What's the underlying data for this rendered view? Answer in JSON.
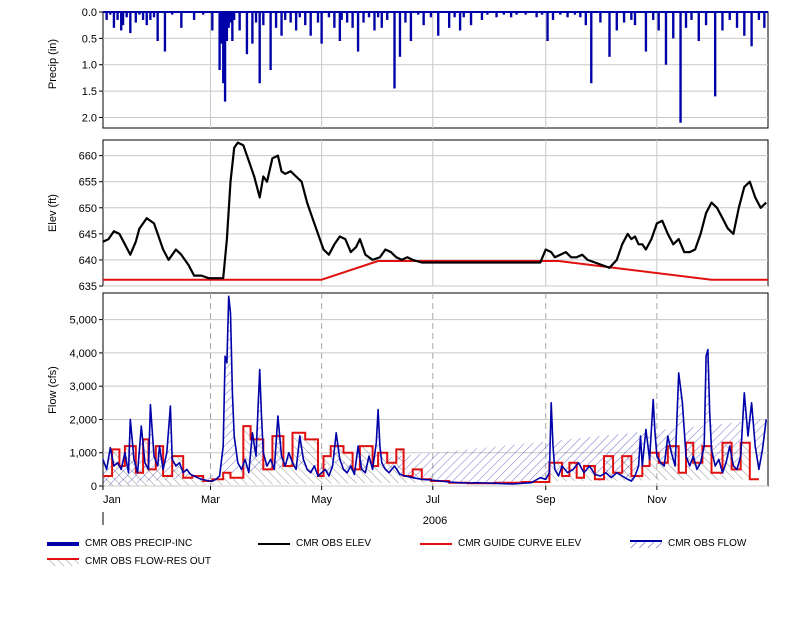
{
  "chart_data": [
    {
      "type": "bar",
      "ylabel": "Precip (in)",
      "ylim": [
        0.0,
        2.2
      ],
      "y_inverted": true,
      "yticks": [
        "0.0",
        "0.5",
        "1.0",
        "1.5",
        "2.0"
      ],
      "ytick_values": [
        0.0,
        0.5,
        1.0,
        1.5,
        2.0
      ],
      "color": "#0000a8",
      "x_days": [
        2,
        4,
        6,
        8,
        10,
        11,
        13,
        15,
        18,
        20,
        22,
        24,
        26,
        28,
        30,
        34,
        38,
        43,
        50,
        55,
        60,
        64,
        65,
        66,
        67,
        68,
        69,
        70,
        71,
        72,
        75,
        79,
        82,
        84,
        86,
        88,
        92,
        95,
        98,
        100,
        103,
        106,
        108,
        111,
        114,
        118,
        120,
        124,
        127,
        130,
        131,
        134,
        137,
        140,
        143,
        146,
        149,
        151,
        153,
        156,
        160,
        163,
        166,
        169,
        173,
        176,
        180,
        184,
        190,
        193,
        196,
        198,
        202,
        208,
        211,
        216,
        220,
        224,
        227,
        232,
        238,
        241,
        244,
        247,
        251,
        255,
        259,
        262,
        265,
        268,
        273,
        278,
        282,
        286,
        290,
        292,
        298,
        302,
        305,
        309,
        313,
        317,
        320,
        323,
        327,
        331,
        336,
        340,
        344,
        348,
        352,
        356,
        360,
        363
      ],
      "values": [
        0.15,
        0.05,
        0.3,
        0.15,
        0.35,
        0.25,
        0.1,
        0.4,
        0.2,
        0.05,
        0.15,
        0.25,
        0.15,
        0.1,
        0.55,
        0.75,
        0.05,
        0.3,
        0.15,
        0.05,
        0.35,
        1.1,
        0.6,
        1.35,
        1.7,
        0.55,
        0.3,
        0.2,
        0.55,
        0.15,
        0.35,
        0.8,
        0.6,
        0.2,
        1.35,
        0.25,
        1.1,
        0.3,
        0.45,
        0.15,
        0.2,
        0.35,
        0.1,
        0.25,
        0.45,
        0.2,
        0.6,
        0.1,
        0.3,
        0.55,
        0.15,
        0.2,
        0.3,
        0.75,
        0.2,
        0.1,
        0.35,
        0.1,
        0.3,
        0.15,
        1.45,
        0.85,
        0.2,
        0.55,
        0.05,
        0.25,
        0.1,
        0.45,
        0.3,
        0.1,
        0.35,
        0.1,
        0.25,
        0.15,
        0.05,
        0.1,
        0.05,
        0.1,
        0.05,
        0.05,
        0.1,
        0.05,
        0.55,
        0.15,
        0.05,
        0.1,
        0.05,
        0.1,
        0.25,
        1.35,
        0.2,
        0.85,
        0.35,
        0.2,
        0.15,
        0.25,
        0.75,
        0.15,
        0.35,
        1.0,
        0.5,
        2.1,
        0.3,
        0.15,
        0.55,
        0.25,
        1.6,
        0.35,
        0.15,
        0.3,
        0.45,
        0.65,
        0.15,
        0.3,
        0.75,
        0.45
      ]
    },
    {
      "type": "line",
      "ylabel": "Elev (ft)",
      "ylim": [
        635,
        663
      ],
      "yticks": [
        "635",
        "640",
        "645",
        "650",
        "655",
        "660"
      ],
      "ytick_values": [
        635,
        640,
        645,
        650,
        655,
        660
      ],
      "series": [
        {
          "name": "CMR OBS ELEV",
          "color": "#000000",
          "x_days": [
            0,
            3,
            6,
            9,
            12,
            15,
            18,
            20,
            24,
            28,
            30,
            33,
            36,
            40,
            43,
            47,
            50,
            54,
            58,
            62,
            66,
            68,
            70,
            72,
            74,
            77,
            80,
            83,
            86,
            88,
            90,
            93,
            96,
            98,
            100,
            103,
            106,
            109,
            112,
            115,
            118,
            121,
            124,
            127,
            130,
            133,
            136,
            139,
            141,
            144,
            148,
            152,
            155,
            158,
            161,
            164,
            167,
            170,
            175,
            180,
            190,
            200,
            210,
            220,
            230,
            240,
            243,
            246,
            248,
            251,
            254,
            257,
            260,
            263,
            266,
            270,
            274,
            278,
            282,
            285,
            288,
            290,
            292,
            294,
            296,
            298,
            301,
            304,
            307,
            310,
            313,
            316,
            319,
            322,
            325,
            328,
            331,
            334,
            337,
            340,
            343,
            346,
            349,
            352,
            355,
            358,
            361,
            364
          ],
          "y": [
            643.5,
            644,
            645.5,
            645,
            643,
            641,
            643.5,
            646,
            648,
            647,
            645,
            642,
            640,
            642,
            641,
            639,
            637,
            637,
            636.5,
            636.5,
            636.5,
            644,
            655,
            661.5,
            662.5,
            662,
            659,
            656,
            652,
            656,
            655,
            659.5,
            660,
            657,
            656.5,
            657,
            656,
            655,
            651,
            648,
            645,
            642,
            641,
            643,
            644.5,
            644,
            641.5,
            642.5,
            644,
            641,
            640,
            640.5,
            642,
            641.5,
            640.5,
            640,
            640.5,
            640,
            639.5,
            639.5,
            639.5,
            639.5,
            639.5,
            639.5,
            639.5,
            639.5,
            642,
            641.5,
            640.5,
            641,
            641.5,
            640.5,
            640.5,
            641,
            640,
            639.5,
            639,
            638.5,
            640,
            643,
            645,
            644,
            644.5,
            643,
            643,
            642,
            644,
            647,
            647.5,
            645,
            643,
            644,
            641.5,
            641.5,
            642,
            645,
            649,
            651,
            650,
            648,
            646,
            645,
            650,
            654,
            655,
            652,
            650,
            651,
            653,
            652
          ]
        },
        {
          "name": "CMR GUIDE CURVE ELEV",
          "color": "#e01010",
          "x_days": [
            0,
            120,
            151,
            250,
            334,
            365
          ],
          "y": [
            636.2,
            636.2,
            639.8,
            639.8,
            636.2,
            636.2
          ]
        }
      ]
    },
    {
      "type": "area",
      "ylabel": "Flow (cfs)",
      "ylim": [
        0,
        5800
      ],
      "yticks": [
        "0",
        "1,000",
        "2,000",
        "3,000",
        "4,000",
        "5,000"
      ],
      "ytick_values": [
        0,
        1000,
        2000,
        3000,
        4000,
        5000
      ],
      "xlabel": "2006",
      "xticks": [
        "Jan",
        "Mar",
        "May",
        "Jul",
        "Sep",
        "Nov"
      ],
      "xtick_days": [
        0,
        59,
        120,
        181,
        243,
        304
      ],
      "series": [
        {
          "name": "CMR OBS FLOW",
          "color": "#0000a8",
          "x_days": [
            0,
            2,
            4,
            6,
            8,
            10,
            12,
            14,
            15,
            17,
            19,
            21,
            23,
            25,
            26,
            28,
            30,
            31,
            33,
            35,
            37,
            38,
            40,
            42,
            44,
            46,
            48,
            50,
            52,
            54,
            56,
            58,
            60,
            62,
            64,
            66,
            67,
            68,
            69,
            70,
            71,
            72,
            74,
            76,
            78,
            80,
            82,
            84,
            86,
            87,
            88,
            90,
            92,
            94,
            96,
            98,
            100,
            102,
            104,
            106,
            108,
            110,
            112,
            114,
            116,
            118,
            120,
            122,
            124,
            126,
            128,
            130,
            132,
            134,
            136,
            138,
            140,
            142,
            144,
            146,
            148,
            150,
            151,
            152,
            153,
            155,
            157,
            160,
            163,
            166,
            170,
            175,
            180,
            185,
            190,
            195,
            200,
            205,
            210,
            215,
            220,
            225,
            230,
            235,
            240,
            243,
            245,
            246,
            247,
            248,
            250,
            252,
            255,
            258,
            261,
            264,
            267,
            270,
            273,
            276,
            279,
            282,
            285,
            288,
            290,
            292,
            294,
            295,
            296,
            298,
            300,
            302,
            303,
            304,
            306,
            308,
            310,
            312,
            314,
            316,
            318,
            320,
            322,
            324,
            326,
            328,
            330,
            331,
            332,
            333,
            334,
            336,
            338,
            340,
            342,
            344,
            346,
            348,
            350,
            352,
            354,
            356,
            358,
            360,
            362,
            364,
            365
          ],
          "y": [
            800,
            500,
            1150,
            600,
            700,
            500,
            1000,
            400,
            2000,
            800,
            400,
            1800,
            700,
            500,
            2450,
            900,
            600,
            1200,
            500,
            1000,
            2400,
            800,
            600,
            700,
            400,
            500,
            350,
            300,
            250,
            200,
            180,
            150,
            150,
            200,
            300,
            1200,
            3900,
            3700,
            5700,
            5200,
            2800,
            1500,
            700,
            500,
            800,
            400,
            1600,
            900,
            3500,
            2100,
            1000,
            600,
            800,
            500,
            2100,
            900,
            600,
            1000,
            700,
            500,
            1500,
            800,
            500,
            400,
            600,
            300,
            400,
            500,
            300,
            600,
            1600,
            800,
            500,
            400,
            600,
            350,
            1200,
            500,
            400,
            900,
            500,
            1300,
            2300,
            1200,
            700,
            500,
            400,
            600,
            350,
            300,
            250,
            200,
            180,
            150,
            120,
            100,
            90,
            100,
            90,
            80,
            70,
            60,
            80,
            100,
            250,
            200,
            400,
            2500,
            1200,
            500,
            300,
            600,
            400,
            500,
            700,
            400,
            600,
            350,
            300,
            400,
            250,
            400,
            300,
            200,
            150,
            300,
            600,
            1500,
            600,
            1700,
            800,
            2600,
            1600,
            900,
            700,
            600,
            1500,
            1000,
            600,
            3400,
            2500,
            900,
            600,
            900,
            500,
            700,
            1200,
            3900,
            4100,
            2200,
            1100,
            600,
            800,
            400,
            700,
            1200,
            600,
            500,
            900,
            2800,
            1500,
            2500,
            1200,
            500,
            1100,
            2000
          ]
        },
        {
          "name": "CMR OBS FLOW-RES OUT",
          "color": "#e01010",
          "x_days": [
            0,
            5,
            5,
            9,
            9,
            12,
            12,
            18,
            18,
            22,
            22,
            25,
            25,
            29,
            29,
            33,
            33,
            38,
            38,
            44,
            44,
            49,
            49,
            55,
            55,
            60,
            60,
            66,
            66,
            70,
            70,
            77,
            77,
            81,
            81,
            88,
            88,
            93,
            93,
            99,
            99,
            104,
            104,
            111,
            111,
            118,
            118,
            121,
            121,
            125,
            125,
            132,
            132,
            137,
            137,
            141,
            141,
            148,
            148,
            151,
            151,
            156,
            156,
            161,
            161,
            165,
            165,
            170,
            170,
            175,
            175,
            180,
            180,
            190,
            190,
            200,
            200,
            215,
            215,
            230,
            230,
            245,
            245,
            252,
            252,
            256,
            256,
            260,
            260,
            264,
            264,
            270,
            270,
            275,
            275,
            280,
            280,
            285,
            285,
            290,
            290,
            296,
            296,
            300,
            300,
            305,
            305,
            310,
            310,
            316,
            316,
            320,
            320,
            324,
            324,
            329,
            329,
            334,
            334,
            340,
            340,
            345,
            345,
            350,
            350,
            355,
            355,
            360,
            360,
            365
          ],
          "y": [
            300,
            300,
            1100,
            1100,
            600,
            600,
            1200,
            1200,
            400,
            400,
            1400,
            1400,
            500,
            500,
            1200,
            1200,
            300,
            300,
            900,
            900,
            250,
            250,
            300,
            300,
            150,
            150,
            200,
            200,
            400,
            400,
            250,
            250,
            1800,
            1800,
            1400,
            1400,
            500,
            500,
            1500,
            1500,
            600,
            600,
            1600,
            1600,
            1400,
            1400,
            300,
            300,
            900,
            900,
            1200,
            1200,
            1000,
            1000,
            500,
            500,
            1200,
            1200,
            600,
            600,
            1000,
            1000,
            700,
            700,
            1100,
            1100,
            300,
            300,
            500,
            500,
            200,
            200,
            150,
            150,
            100,
            100,
            80,
            80,
            100,
            100,
            120,
            120,
            700,
            700,
            300,
            300,
            700,
            700,
            250,
            250,
            600,
            600,
            200,
            200,
            900,
            900,
            400,
            400,
            900,
            900,
            300,
            300,
            600,
            600,
            1000,
            1000,
            700,
            700,
            1200,
            1200,
            400,
            400,
            1300,
            1300,
            700,
            700,
            1200,
            1200,
            400,
            400,
            1300,
            1300,
            500,
            500,
            1300,
            1300,
            200,
            200
          ]
        }
      ]
    }
  ],
  "legend": {
    "items": [
      {
        "label": "CMR OBS PRECIP-INC",
        "color": "#0000a8",
        "style": "thick-bar"
      },
      {
        "label": "CMR OBS ELEV",
        "color": "#000000",
        "style": "line"
      },
      {
        "label": "CMR GUIDE CURVE ELEV",
        "color": "#e01010",
        "style": "line"
      },
      {
        "label": "CMR OBS FLOW",
        "color": "#0000a8",
        "style": "hatched-line"
      },
      {
        "label": "CMR OBS FLOW-RES OUT",
        "color": "#e01010",
        "style": "hatched-line"
      }
    ]
  }
}
